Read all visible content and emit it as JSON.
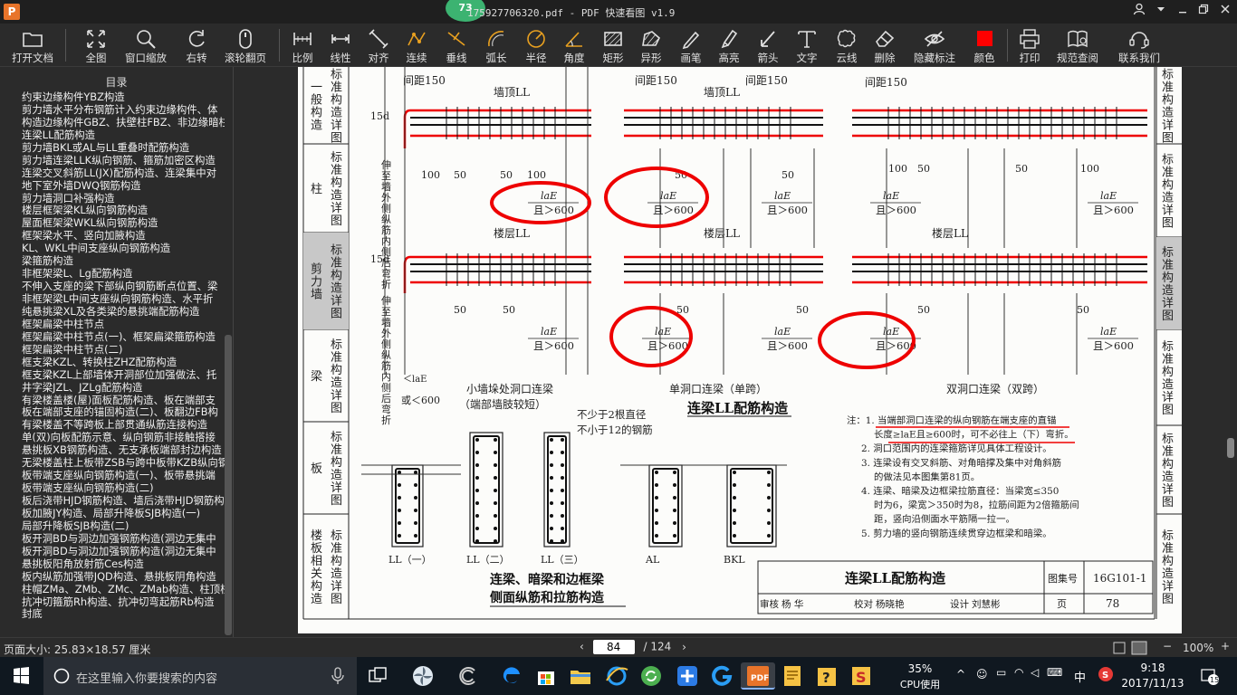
{
  "titlebar": {
    "app_logo": "P",
    "badge": "73",
    "title": "175927706320.pdf - PDF 快速看图 v1.9"
  },
  "toolbar": {
    "items": [
      {
        "label": "打开文档",
        "icon": "folder-icon"
      },
      {
        "label": "全图",
        "icon": "fit-page-icon"
      },
      {
        "label": "窗口缩放",
        "icon": "zoom-icon"
      },
      {
        "label": "右转",
        "icon": "rotate-right-icon"
      },
      {
        "label": "滚轮翻页",
        "icon": "mouse-wheel-icon"
      },
      {
        "label": "比例",
        "icon": "scale-ruler-icon"
      },
      {
        "label": "线性",
        "icon": "linear-measure-icon"
      },
      {
        "label": "对齐",
        "icon": "aligned-measure-icon"
      },
      {
        "label": "连续",
        "icon": "continuous-measure-icon"
      },
      {
        "label": "垂线",
        "icon": "perpendicular-icon"
      },
      {
        "label": "弧长",
        "icon": "arc-length-icon"
      },
      {
        "label": "半径",
        "icon": "radius-icon"
      },
      {
        "label": "角度",
        "icon": "angle-icon"
      },
      {
        "label": "矩形",
        "icon": "rectangle-area-icon"
      },
      {
        "label": "异形",
        "icon": "polygon-area-icon"
      },
      {
        "label": "画笔",
        "icon": "pen-icon"
      },
      {
        "label": "高亮",
        "icon": "highlighter-icon"
      },
      {
        "label": "箭头",
        "icon": "arrow-icon"
      },
      {
        "label": "文字",
        "icon": "text-icon"
      },
      {
        "label": "云线",
        "icon": "cloud-line-icon"
      },
      {
        "label": "删除",
        "icon": "eraser-icon"
      },
      {
        "label": "隐藏标注",
        "icon": "hide-annotation-icon"
      },
      {
        "label": "颜色",
        "icon": "color-swatch-icon",
        "color": "#ff0000"
      },
      {
        "label": "打印",
        "icon": "printer-icon"
      },
      {
        "label": "规范查阅",
        "icon": "book-icon"
      },
      {
        "label": "联系我们",
        "icon": "contact-icon"
      }
    ]
  },
  "sidebar": {
    "title": "目录",
    "items": [
      "约束边缘构件YBZ构造",
      "剪力墙水平分布钢筋计入约束边缘构件、体",
      "构造边缘构件GBZ、扶壁柱FBZ、非边缘暗柱",
      "连梁LL配筋构造",
      "剪力墙BKL或AL与LL重叠时配筋构造",
      "剪力墙连梁LLK纵向钢筋、箍筋加密区构造",
      "连梁交叉斜筋LL(JX)配筋构造、连梁集中对",
      "地下室外墙DWQ钢筋构造",
      "剪力墙洞口补强构造",
      "楼层框架梁KL纵向钢筋构造",
      "屋面框架梁WKL纵向钢筋构造",
      "框架梁水平、竖向加腋构造",
      "KL、WKL中间支座纵向钢筋构造",
      "梁箍筋构造",
      "非框架梁L、Lg配筋构造",
      "不伸入支座的梁下部纵向钢筋断点位置、梁",
      "非框架梁L中间支座纵向钢筋构造、水平折",
      "纯悬挑梁XL及各类梁的悬挑端配筋构造",
      "框架扁梁中柱节点",
      "框架扁梁中柱节点(一)、框架扁梁箍筋构造",
      "框架扁梁中柱节点(二)",
      "框支梁KZL、转换柱ZHZ配筋构造",
      "框支梁KZL上部墙体开洞部位加强做法、托",
      "井字梁JZL、JZLg配筋构造",
      "有梁楼盖楼(屋)面板配筋构造、板在端部支",
      "板在端部支座的锚固构造(二)、板翻边FB构",
      "有梁楼盖不等跨板上部贯通纵筋连接构造",
      "单(双)向板配筋示意、纵向钢筋非接触搭接",
      "悬挑板XB钢筋构造、无支承板端部封边构造",
      "无梁楼盖柱上板带ZSB与跨中板带KZB纵向钢",
      "板带端支座纵向钢筋构造(一)、板带悬挑端",
      "板带端支座纵向钢筋构造(二)",
      "板后浇带HJD钢筋构造、墙后浇带HJD钢筋构",
      "板加腋JY构造、局部升降板SJB构造(一)",
      "局部升降板SJB构造(二)",
      "板开洞BD与洞边加强钢筋构造(洞边无集中",
      "板开洞BD与洞边加强钢筋构造(洞边无集中",
      "悬挑板阳角放射筋Ces构造",
      "板内纵筋加强带JQD构造、悬挑板阴角构造",
      "柱帽ZMa、ZMb、ZMc、ZMab构造、柱顶柱帽",
      "抗冲切箍筋Rh构造、抗冲切弯起筋Rb构造",
      "封底"
    ]
  },
  "document": {
    "left_tabs": [
      {
        "text": "一般构造",
        "sub": "标准构造详图"
      },
      {
        "text": "柱",
        "sub": "标准构造详图"
      },
      {
        "text": "剪力墙",
        "sub": "标准构造详图"
      },
      {
        "text": "梁",
        "sub": "标准构造详图"
      },
      {
        "text": "板",
        "sub": "标准构造详图"
      },
      {
        "text": "楼板相关构造",
        "sub": "标准构造详图"
      }
    ],
    "right_tabs": [
      "标准构造详图",
      "标准构造详图",
      "标准构造详图",
      "标准构造详图",
      "标准构造详图",
      "标准构造详图"
    ],
    "spacing_label": "间距150",
    "top_beam": "墙顶LL",
    "floor_beam": "楼层LL",
    "dim_100": "100",
    "dim_50": "50",
    "dim_15d": "15d",
    "lae": "laE",
    "lae_cond": "且＞600",
    "side_bar_note": "伸至墙外侧纵筋内侧后弯折",
    "lae_or": "＜laE",
    "or_600": "或＜600",
    "cap_small": "小墙垛处洞口连梁",
    "cap_small_sub": "（端部墙肢较短）",
    "cap_single": "单洞口连梁（单跨）",
    "cap_double": "双洞口连梁（双跨）",
    "main_title": "连梁LL配筋构造",
    "notes": [
      "注：1. 当端部洞口连梁的纵向钢筋在端支座的直锚",
      "长度≥laE且≥600时，可不必往上（下）弯折。",
      "2. 洞口范围内的连梁箍筋详见具体工程设计。",
      "3. 连梁设有交叉斜筋、对角暗撑及集中对角斜筋",
      "的做法见本图集第81页。",
      "4. 连梁、暗梁及边框梁拉筋直径：当梁宽≤350",
      "时为6，梁宽＞350时为8，拉筋间距为2倍箍筋间",
      "距，竖向沿侧面水平筋隔一拉一。",
      "5. 剪力墙的竖向钢筋连续贯穿边框梁和暗梁。"
    ],
    "rebar_note1": "不少于2根直径",
    "rebar_note2": "不小于12的钢筋",
    "sections": [
      "LL（一）",
      "LL（二）",
      "LL（三）",
      "AL",
      "BKL"
    ],
    "sec_title1": "连梁、暗梁和边框梁",
    "sec_title2": "侧面纵筋和拉筋构造",
    "tb_title": "连梁LL配筋构造",
    "tb_atlas_label": "图集号",
    "tb_atlas": "16G101-1",
    "tb_page_label": "页",
    "tb_page": "78",
    "tb_review": "审核",
    "tb_reviewer": "杨 华",
    "tb_check": "校对",
    "tb_checker": "杨晓艳",
    "tb_design": "设计",
    "tb_designer": "刘慧彬"
  },
  "status": {
    "page_size": "页面大小: 25.83×18.57 厘米",
    "current_page": "84",
    "total_pages": "/ 124",
    "zoom": "100%"
  },
  "taskbar": {
    "search_placeholder": "在这里输入你要搜索的内容",
    "cpu_percent": "35%",
    "cpu_label": "CPU使用",
    "ime": "中",
    "time": "9:18",
    "date": "2017/11/13",
    "notifications": "15"
  }
}
